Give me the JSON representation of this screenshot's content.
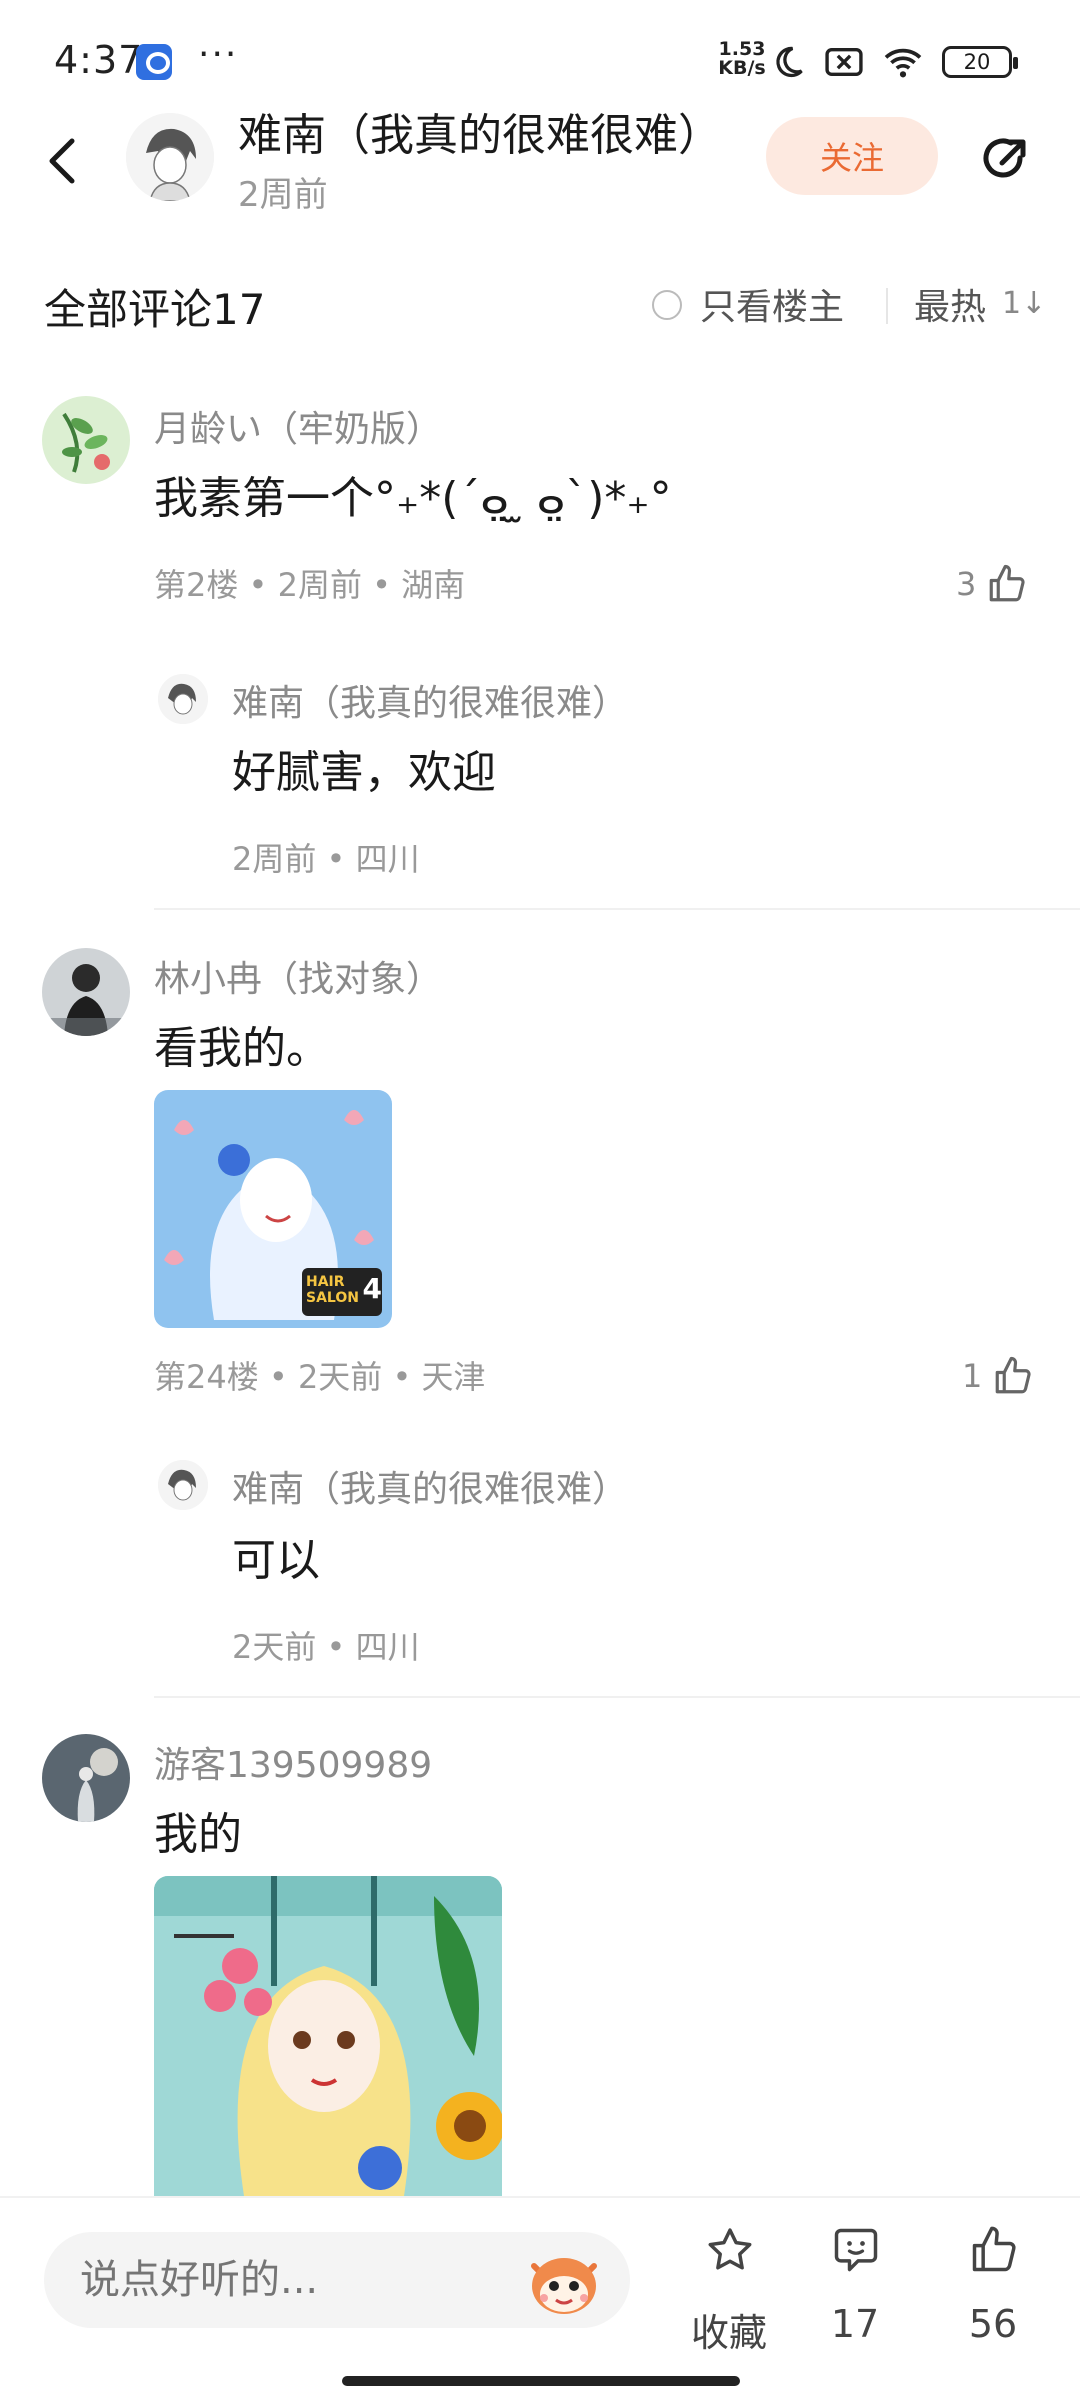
{
  "status_bar": {
    "time": "4:37",
    "more": "···",
    "net_speed_value": "1.53",
    "net_speed_unit": "KB/s",
    "battery": "20"
  },
  "header": {
    "title": "难南（我真的很难很难）",
    "subtitle": "2周前",
    "follow_label": "关注"
  },
  "filter": {
    "comment_count_label": "全部评论17",
    "only_op_label": "只看楼主",
    "sort_label": "最热",
    "sort_icon": "1↓"
  },
  "comments": [
    {
      "name": "月龄い（牢奶版）",
      "text": "我素第一个°₊*(´ⴰ̤ ̫ ⴰ̤`)*₊°",
      "meta": "第2楼 • 2周前 • 湖南",
      "likes": "3",
      "reply": {
        "name": "难南（我真的很难很难）",
        "text": "好腻害，欢迎",
        "meta": "2周前 • 四川"
      }
    },
    {
      "name": "林小冉（找对象）",
      "text": "看我的。",
      "meta": "第24楼 • 2天前 • 天津",
      "likes": "1",
      "image_badge_line1": "HAIR",
      "image_badge_line2": "SALON",
      "image_badge_num": "4",
      "reply": {
        "name": "难南（我真的很难很难）",
        "text": "可以",
        "meta": "2天前 • 四川"
      }
    },
    {
      "name": "游客139509989",
      "text": "我的"
    }
  ],
  "bottom_bar": {
    "input_placeholder": "说点好听的...",
    "favorite_label": "收藏",
    "comment_count": "17",
    "like_count": "56"
  },
  "colors": {
    "accent": "#ea6a33",
    "follow_bg": "#fde9e0",
    "muted_text": "#999999"
  }
}
